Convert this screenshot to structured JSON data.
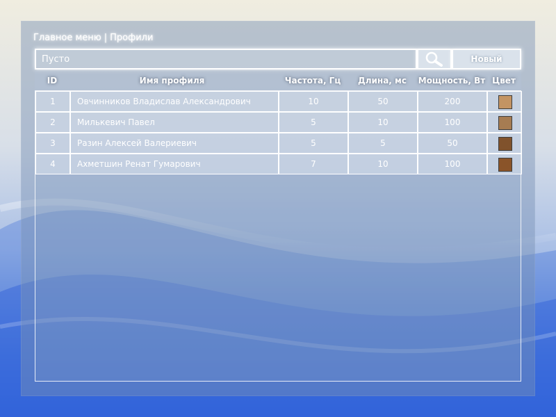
{
  "breadcrumb": {
    "home": "Главное меню",
    "separator": "|",
    "current": "Профили"
  },
  "search": {
    "value": "",
    "placeholder": "Пусто"
  },
  "toolbar": {
    "new_label": "Новый",
    "search_icon": "search-icon"
  },
  "table": {
    "columns": [
      "ID",
      "Имя профиля",
      "Частота, Гц",
      "Длина, мс",
      "Мощность, Вт",
      "Цвет"
    ],
    "rows": [
      {
        "id": "1",
        "name": "Овчинников Владислав Александрович",
        "freq": "10",
        "length": "50",
        "power": "200",
        "color": "#c39463"
      },
      {
        "id": "2",
        "name": "Милькевич Павел",
        "freq": "5",
        "length": "10",
        "power": "100",
        "color": "#a67c52"
      },
      {
        "id": "3",
        "name": "Разин Алексей Валериевич",
        "freq": "5",
        "length": "5",
        "power": "50",
        "color": "#80522c"
      },
      {
        "id": "4",
        "name": "Ахметшин Ренат Гумарович",
        "freq": "7",
        "length": "10",
        "power": "100",
        "color": "#8a5429"
      }
    ]
  }
}
